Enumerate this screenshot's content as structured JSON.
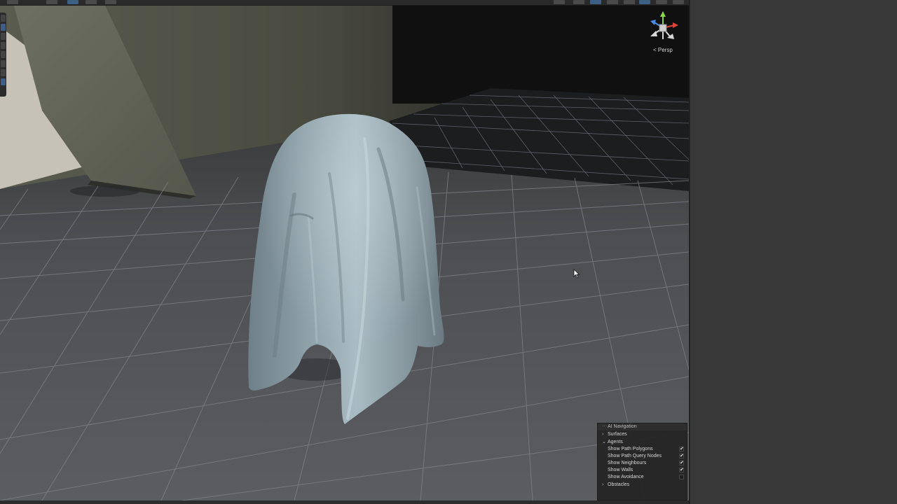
{
  "scene_view": {
    "projection_label": "< Persp"
  },
  "ai_navigation_overlay": {
    "title": "AI Navigation",
    "sections": [
      {
        "label": "Surfaces",
        "expanded": false
      },
      {
        "label": "Agents",
        "expanded": true
      },
      {
        "label": "Obstacles",
        "expanded": false
      }
    ],
    "agent_options": [
      {
        "label": "Show Path Polygons",
        "checked": true
      },
      {
        "label": "Show Path Query Nodes",
        "checked": true
      },
      {
        "label": "Show Neighbours",
        "checked": true
      },
      {
        "label": "Show Walls",
        "checked": true
      },
      {
        "label": "Show Avoidance",
        "checked": false
      }
    ],
    "check_glyph": "✔"
  },
  "colors": {
    "accent_blue": "#3d5f86",
    "cloth": "#8fa1a8",
    "floor": "#54565a",
    "gizmo_y": "#8cd64c",
    "gizmo_x": "#e0463a",
    "gizmo_z": "#4a8be6"
  },
  "icons": {
    "orientation_gizmo": "scene-gizmo-icon",
    "mouse_cursor": "pointer-cursor-icon",
    "expand_arrow": "chevron-right-icon",
    "collapse_arrow": "chevron-down-icon"
  }
}
